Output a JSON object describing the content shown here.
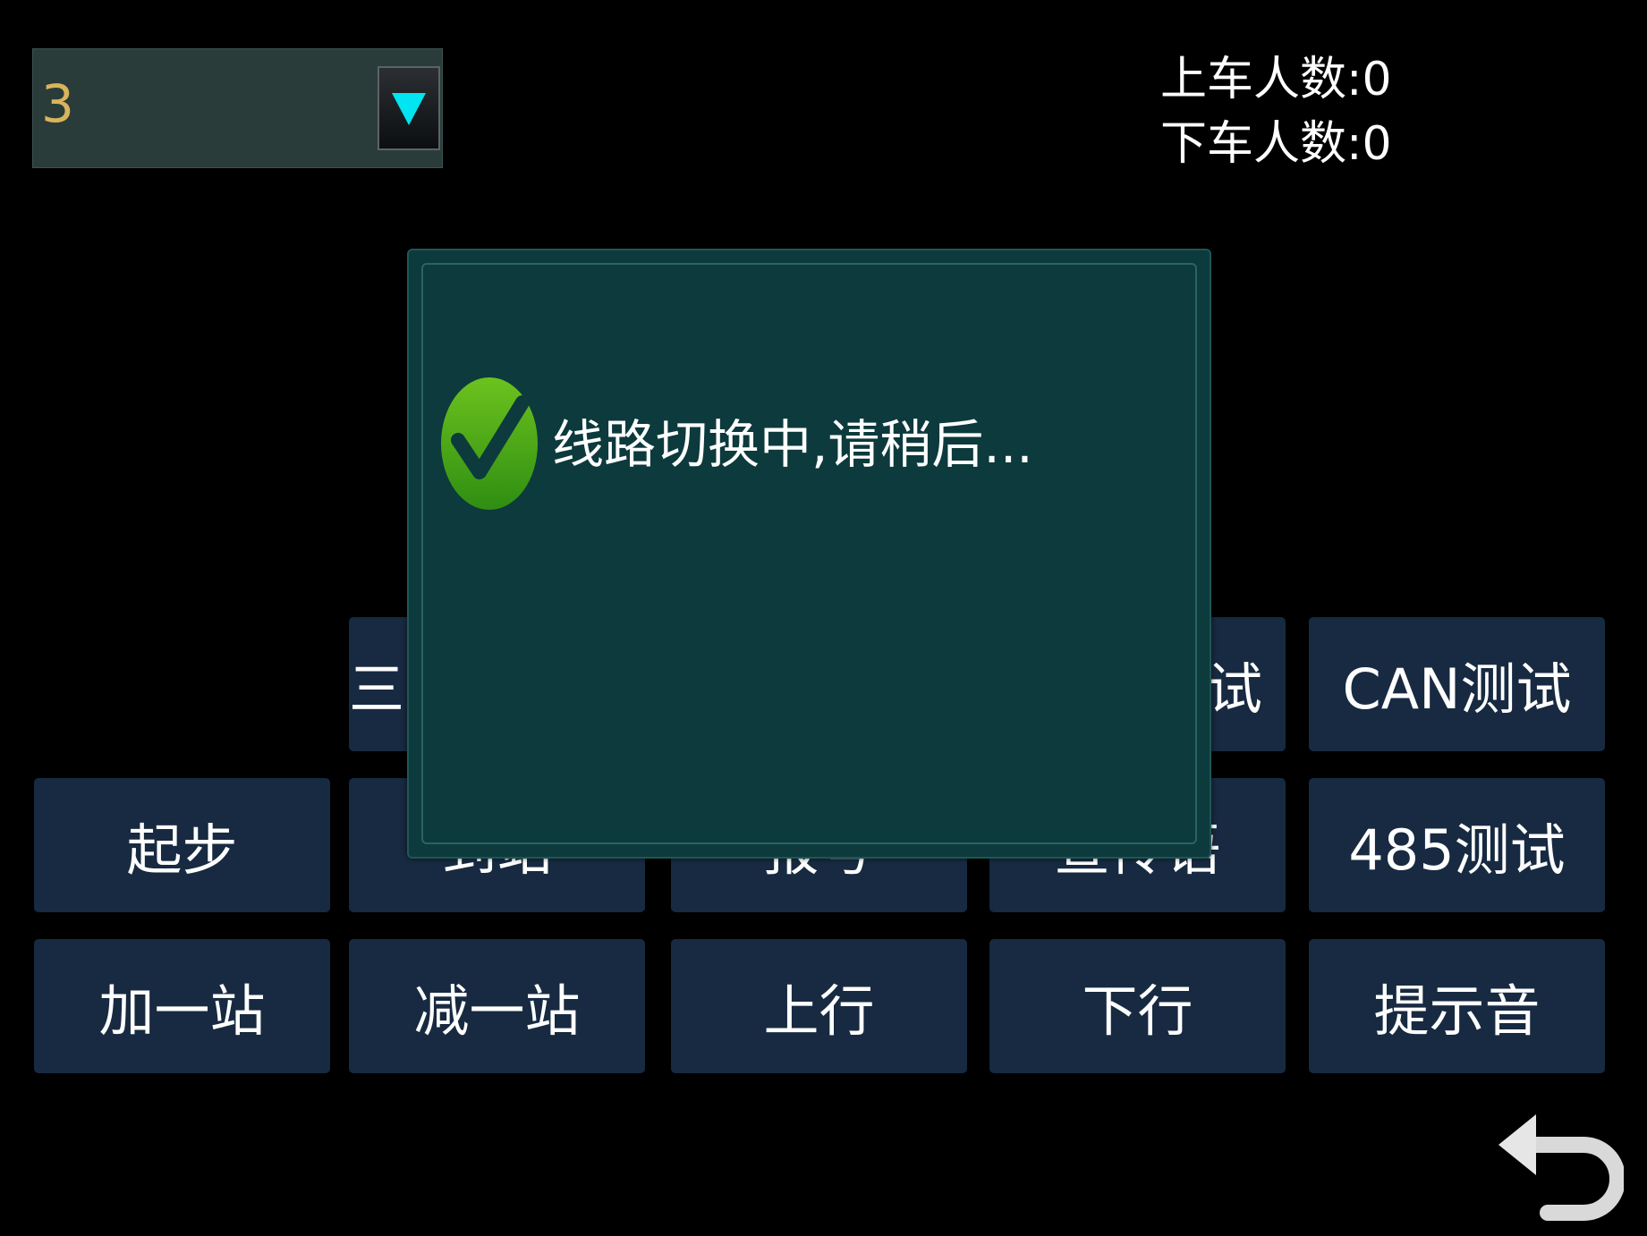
{
  "line_selector": {
    "value": "3",
    "arrow_color": "#00e5f0"
  },
  "counters": {
    "boarding": "上车人数:0",
    "alighting": "下车人数:0"
  },
  "buttons": {
    "row1": [
      "三",
      "试",
      "CAN测试"
    ],
    "row2": [
      "起步",
      "到站",
      "报号",
      "宣传语",
      "485测试"
    ],
    "row3": [
      "加一站",
      "减一站",
      "上行",
      "下行",
      "提示音"
    ]
  },
  "dialog": {
    "message": "线路切换中,请稍后...",
    "icon": "check-icon",
    "icon_color": "#4caf1a"
  },
  "back": {
    "icon": "back-arrow-icon"
  }
}
